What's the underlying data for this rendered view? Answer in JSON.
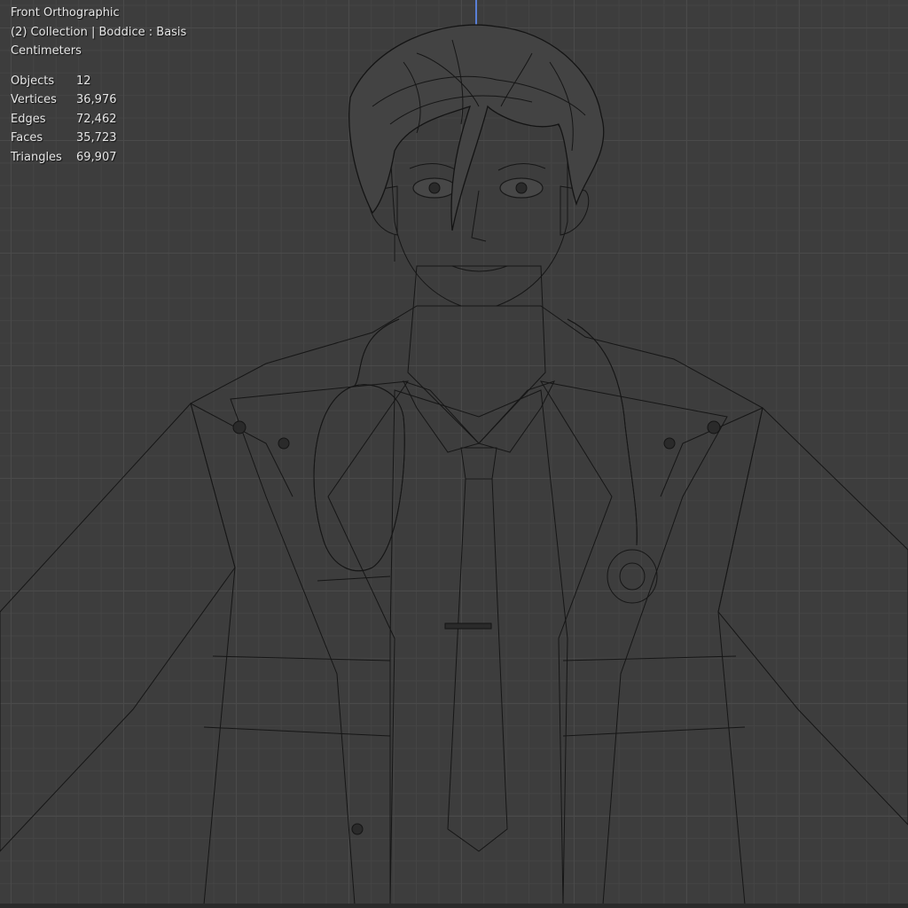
{
  "viewport": {
    "view_name": "Front Orthographic",
    "collection_info": "(2) Collection | Boddice : Basis",
    "units": "Centimeters",
    "stats": [
      {
        "label": "Objects",
        "value": "12"
      },
      {
        "label": "Vertices",
        "value": "36,976"
      },
      {
        "label": "Edges",
        "value": "72,462"
      },
      {
        "label": "Faces",
        "value": "35,723"
      },
      {
        "label": "Triangles",
        "value": "69,907"
      }
    ]
  },
  "colors": {
    "background": "#3d3d3d",
    "grid_major": "#4a4a4a",
    "wire": "#161616",
    "z_axis": "#5a7fd6",
    "overlay_text": "#e6e6e6"
  }
}
